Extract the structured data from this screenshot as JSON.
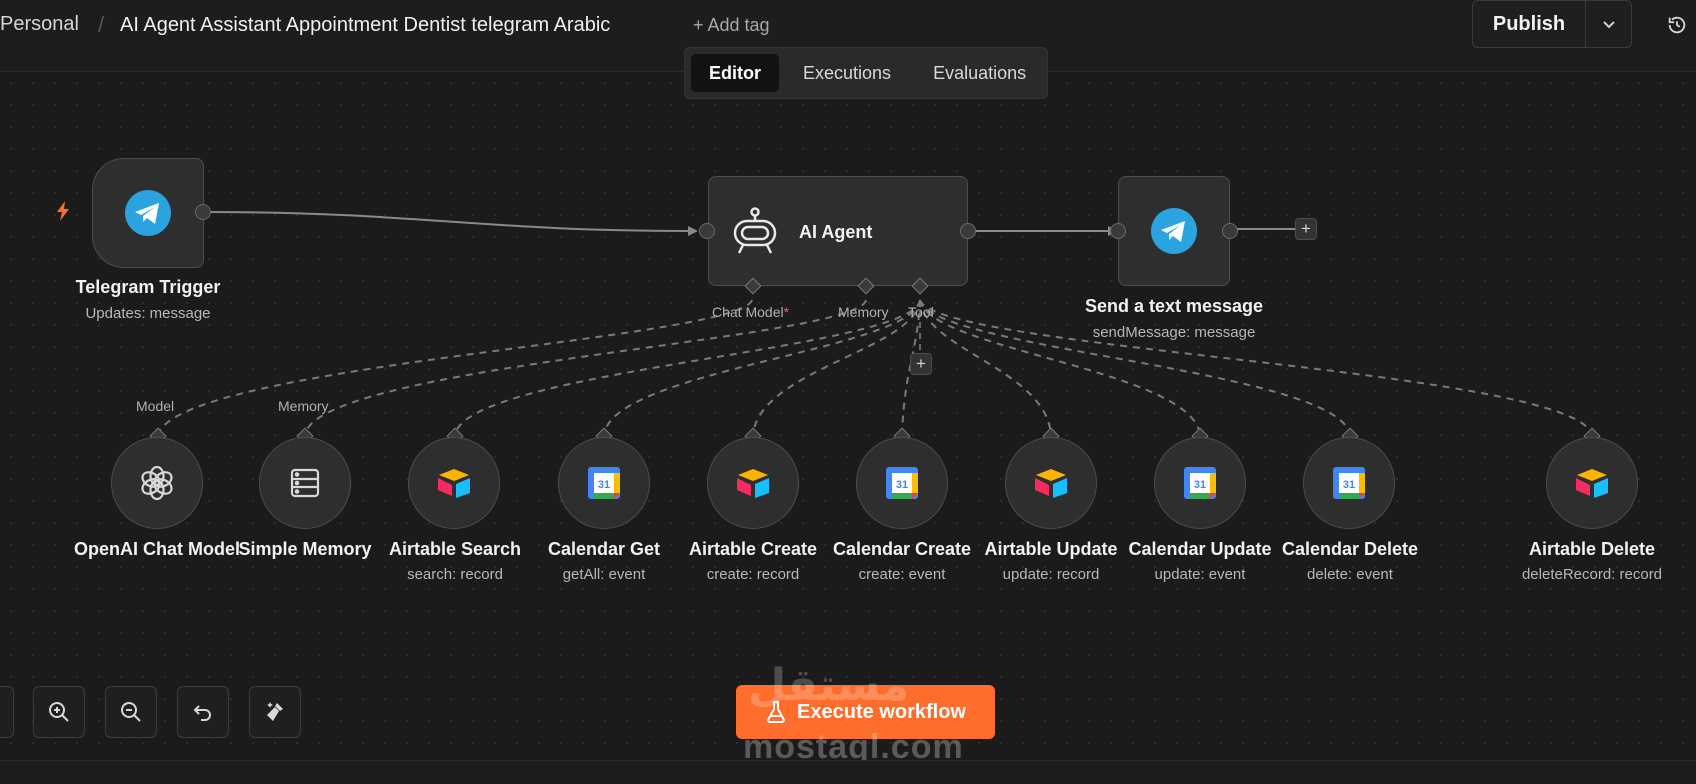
{
  "header": {
    "breadcrumb_root": "Personal",
    "workflow_title": "AI Agent Assistant Appointment Dentist telegram Arabic",
    "add_tag_label": "+ Add tag",
    "publish_label": "Publish"
  },
  "tabs": [
    {
      "label": "Editor",
      "active": true
    },
    {
      "label": "Executions",
      "active": false
    },
    {
      "label": "Evaluations",
      "active": false
    }
  ],
  "nodes": {
    "telegram_trigger": {
      "title": "Telegram Trigger",
      "subtitle": "Updates: message",
      "icon": "telegram-icon"
    },
    "ai_agent": {
      "title": "AI Agent",
      "icon": "robot-icon",
      "ports": {
        "chat_model": "Chat Model",
        "chat_model_required": "*",
        "memory": "Memory",
        "tool": "Tool"
      }
    },
    "send_message": {
      "title": "Send a text message",
      "subtitle": "sendMessage: message",
      "icon": "telegram-icon"
    },
    "subnodes": [
      {
        "title": "OpenAI Chat Model",
        "subtitle": "",
        "icon": "openai-icon",
        "port_label": "Model"
      },
      {
        "title": "Simple Memory",
        "subtitle": "",
        "icon": "memory-icon",
        "port_label": "Memory"
      },
      {
        "title": "Airtable Search",
        "subtitle": "search: record",
        "icon": "airtable-icon",
        "port_label": ""
      },
      {
        "title": "Calendar Get",
        "subtitle": "getAll: event",
        "icon": "google-calendar-icon",
        "port_label": ""
      },
      {
        "title": "Airtable Create",
        "subtitle": "create: record",
        "icon": "airtable-icon",
        "port_label": ""
      },
      {
        "title": "Calendar Create",
        "subtitle": "create: event",
        "icon": "google-calendar-icon",
        "port_label": ""
      },
      {
        "title": "Airtable Update",
        "subtitle": "update: record",
        "icon": "airtable-icon",
        "port_label": ""
      },
      {
        "title": "Calendar Update",
        "subtitle": "update: event",
        "icon": "google-calendar-icon",
        "port_label": ""
      },
      {
        "title": "Calendar Delete",
        "subtitle": "delete: event",
        "icon": "google-calendar-icon",
        "port_label": ""
      },
      {
        "title": "Airtable Delete",
        "subtitle": "deleteRecord: record",
        "icon": "airtable-icon",
        "port_label": ""
      }
    ]
  },
  "calendar_icon_text": "31",
  "plus_label": "+",
  "controls": {
    "execute_label": "Execute workflow",
    "icons": [
      "fit-view-icon",
      "zoom-in-icon",
      "zoom-out-icon",
      "undo-icon",
      "tidy-up-icon"
    ]
  },
  "watermark": {
    "arabic": "مستقل",
    "latin": "mostaql.com"
  },
  "colors": {
    "accent": "#ff6d2d",
    "telegram": "#2aa3df",
    "trigger_bolt": "#ff6d2d",
    "required": "#ff5a5a"
  }
}
